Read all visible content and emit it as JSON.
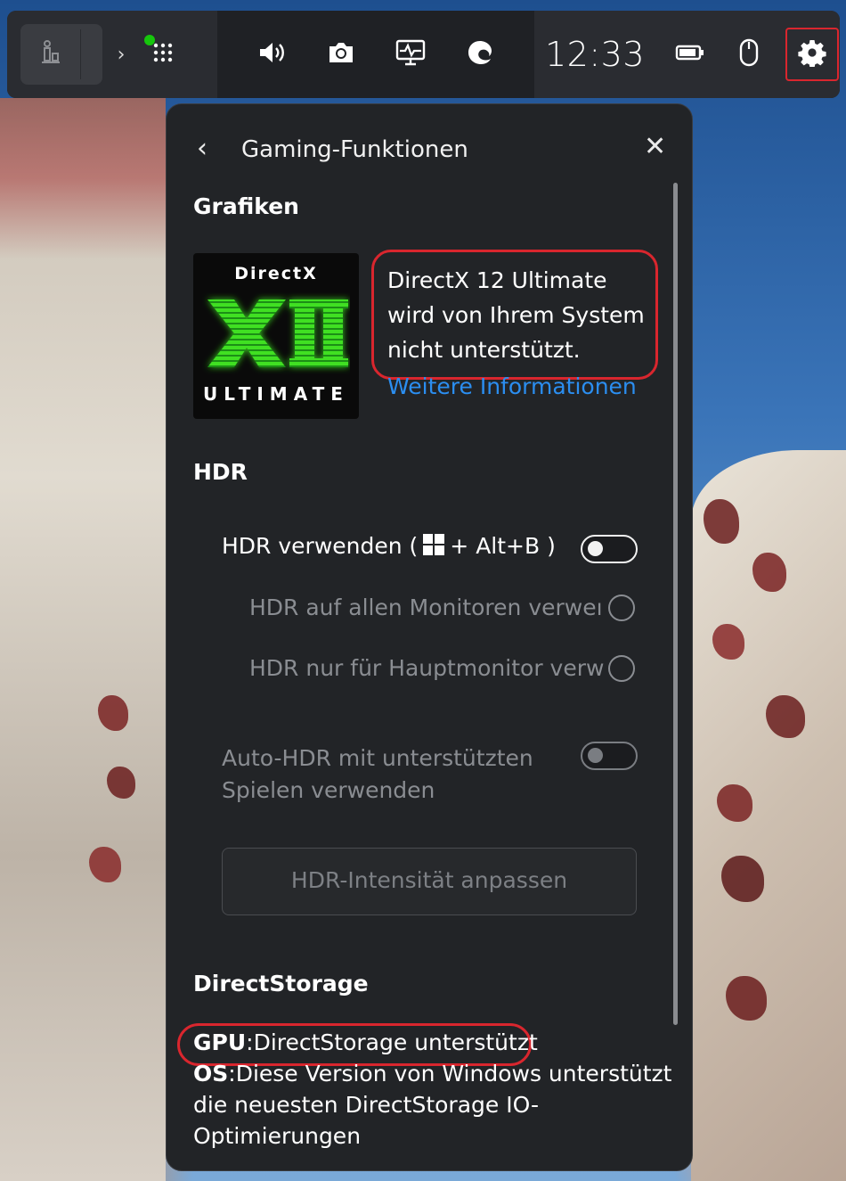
{
  "topbar": {
    "time": "12:33",
    "icons": {
      "widget": "widget-store-icon",
      "chevron": "chevron-right-icon",
      "apps": "apps-grid-icon",
      "volume": "volume-icon",
      "capture": "camera-icon",
      "performance": "performance-monitor-icon",
      "edge": "edge-browser-icon",
      "battery": "battery-icon",
      "mouse": "mouse-icon",
      "settings": "gear-icon"
    }
  },
  "panel": {
    "title": "Gaming-Funktionen",
    "sections": {
      "graphics": {
        "heading": "Grafiken",
        "logo_top": "DirectX",
        "logo_bottom": "ULTIMATE",
        "message": "DirectX 12 Ultimate wird von Ihrem System nicht unterstützt.",
        "link": "Weitere Informationen"
      },
      "hdr": {
        "heading": "HDR",
        "use_hdr_prefix": "HDR verwenden (",
        "use_hdr_suffix": "+ Alt+B )",
        "use_hdr_on": false,
        "all_monitors": "HDR auf allen Monitoren verweı",
        "main_monitor": "HDR nur für Hauptmonitor verw",
        "auto_hdr_line1": "Auto-HDR mit unterstützten",
        "auto_hdr_line2": "Spielen verwenden",
        "auto_hdr_on": false,
        "intensity_button": "HDR-Intensität anpassen"
      },
      "directstorage": {
        "heading": "DirectStorage",
        "gpu_label": "GPU",
        "gpu_text": ":DirectStorage unterstützt",
        "os_label": "OS",
        "os_text": ":Diese Version von Windows unterstützt die neuesten DirectStorage IO-Optimierungen"
      }
    }
  },
  "colors": {
    "accent_red": "#d9262e",
    "link_blue": "#2b8ef0",
    "dx_green": "#37d81f",
    "status_green": "#16c60c"
  }
}
